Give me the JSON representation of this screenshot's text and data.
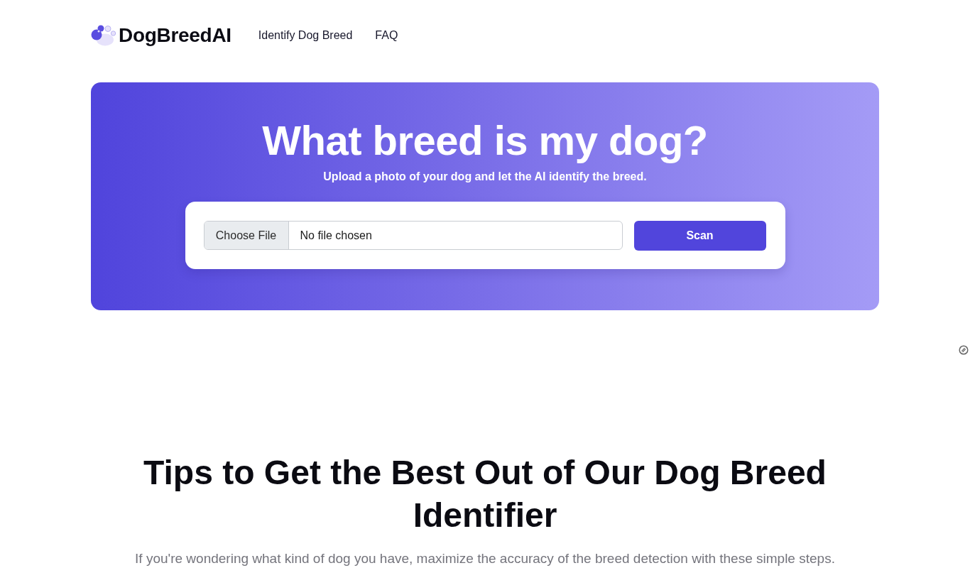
{
  "header": {
    "logo_text": "DogBreedAI",
    "nav_links": [
      "Identify Dog Breed",
      "FAQ"
    ]
  },
  "hero": {
    "title": "What breed is my dog?",
    "subtitle": "Upload a photo of your dog and let the AI identify the breed.",
    "upload": {
      "choose_button": "Choose File",
      "file_status": "No file chosen",
      "submit_button": "Scan"
    }
  },
  "tips": {
    "heading": "Tips to Get the Best Out of Our Dog Breed Identifier",
    "intro": "If you're wondering what kind of dog you have, maximize the accuracy of the breed detection with these simple steps."
  }
}
